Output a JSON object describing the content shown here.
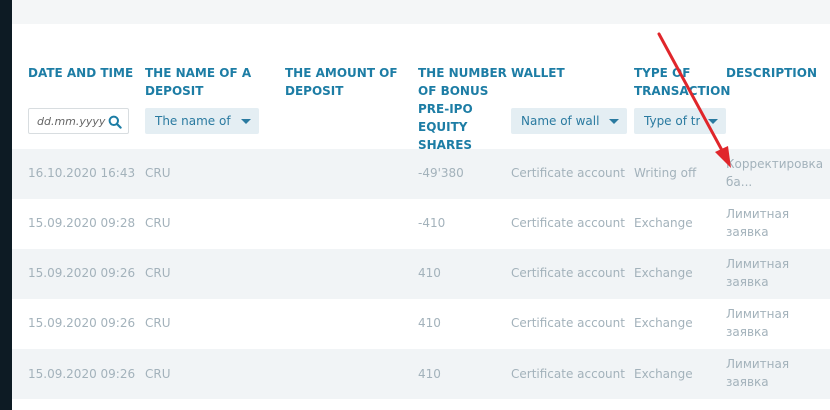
{
  "columns": {
    "date": "DATE AND TIME",
    "deposit_name": "THE NAME OF A DEPOSIT",
    "deposit_amount": "THE AMOUNT OF DEPOSIT",
    "bonus_shares": "THE NUMBER OF BONUS PRE-IPO EQUITY SHARES",
    "wallet": "WALLET",
    "transaction_type": "TYPE OF TRANSACTION",
    "description": "DESCRIPTION"
  },
  "filters": {
    "date_placeholder": "dd.mm.yyyy",
    "deposit_name": "The name of a",
    "wallet": "Name of wall",
    "transaction_type": "Type of tr"
  },
  "rows": [
    {
      "date": "16.10.2020 16:43",
      "deposit": "CRU",
      "amount": "",
      "shares": "-49'380",
      "wallet": "Certificate account",
      "type": "Writing off",
      "description": "Корректировка ба..."
    },
    {
      "date": "15.09.2020 09:28",
      "deposit": "CRU",
      "amount": "",
      "shares": "-410",
      "wallet": "Certificate account",
      "type": "Exchange",
      "description": "Лимитная заявка"
    },
    {
      "date": "15.09.2020 09:26",
      "deposit": "CRU",
      "amount": "",
      "shares": "410",
      "wallet": "Certificate account",
      "type": "Exchange",
      "description": "Лимитная заявка"
    },
    {
      "date": "15.09.2020 09:26",
      "deposit": "CRU",
      "amount": "",
      "shares": "410",
      "wallet": "Certificate account",
      "type": "Exchange",
      "description": "Лимитная заявка"
    },
    {
      "date": "15.09.2020 09:26",
      "deposit": "CRU",
      "amount": "",
      "shares": "410",
      "wallet": "Certificate account",
      "type": "Exchange",
      "description": "Лимитная заявка"
    }
  ],
  "colors": {
    "header_text": "#1d7da5",
    "cell_text": "#a3b2bb",
    "row_shade": "#f1f4f6",
    "annotation_arrow": "#e0262b"
  },
  "icons": {
    "date_search": "search-icon",
    "dropdown": "caret-down-icon"
  }
}
